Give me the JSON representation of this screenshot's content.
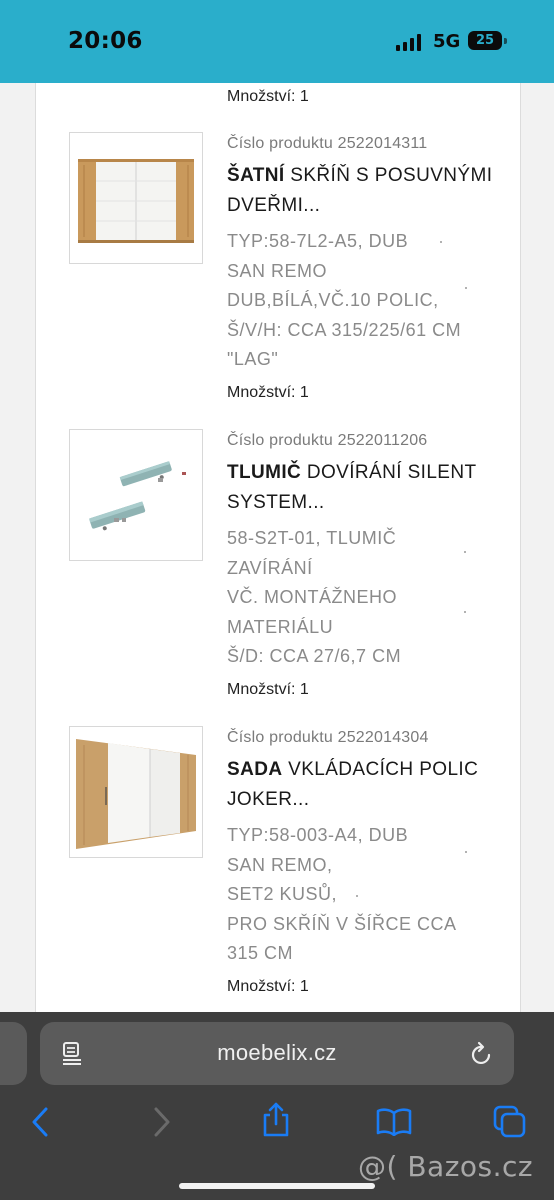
{
  "status_bar": {
    "time": "20:06",
    "network": "5G",
    "battery": "25"
  },
  "order": {
    "top_quantity": "Množství: 1",
    "items": [
      {
        "code": "Číslo produktu 2522014311",
        "title_bold": "ŠATNÍ",
        "title_rest": " SKŘÍŇ S POSUVNÝMI DVEŘMI...",
        "desc_lines": [
          "TYP:58-7L2-A5, DUB",
          "SAN REMO",
          "DUB,BÍLÁ,VČ.10 POLIC,",
          "Š/V/H: CCA 315/225/61 CM",
          "\"LAG\""
        ],
        "quantity": "Množství: 1",
        "image": "wardrobe-sliding-doors"
      },
      {
        "code": "Číslo produktu 2522011206",
        "title_bold": "TLUMIČ",
        "title_rest": " DOVÍRÁNÍ SILENT SYSTEM...",
        "desc_lines": [
          "58-S2T-01, TLUMIČ",
          "ZAVÍRÁNÍ",
          "VČ. MONTÁŽNEHO",
          "MATERIÁLU",
          "Š/D: CCA 27/6,7 CM"
        ],
        "quantity": "Množství: 1",
        "image": "soft-close-damper"
      },
      {
        "code": "Číslo produktu 2522014304",
        "title_bold": "SADA",
        "title_rest": " VKLÁDACÍCH POLIC JOKER...",
        "desc_lines": [
          "TYP:58-003-A4, DUB",
          "SAN REMO,",
          "SET2 KUSŮ,",
          "PRO SKŘÍŇ V ŠÍŘCE CCA",
          "315 CM"
        ],
        "quantity": "Množství: 1",
        "image": "wardrobe-shelves"
      }
    ]
  },
  "browser": {
    "url": "moebelix.cz",
    "icons": [
      "reader-icon",
      "reload-icon",
      "back-icon",
      "forward-icon",
      "share-icon",
      "bookmarks-icon",
      "tabs-icon"
    ]
  },
  "watermark": "@( Bazos.cz",
  "colors": {
    "status_bar": "#2aaecb",
    "browser_chrome": "#3e3e3e",
    "accent_blue": "#1a7cf5"
  }
}
